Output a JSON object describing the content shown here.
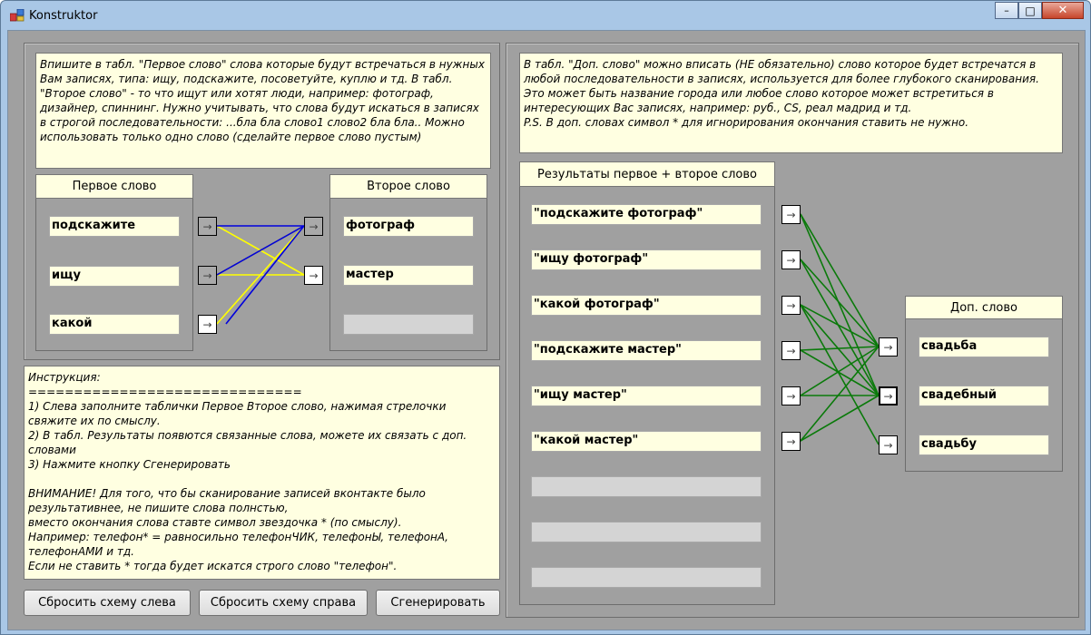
{
  "window": {
    "title": "Konstruktor",
    "minimize_glyph": "–",
    "maximize_glyph": "□",
    "close_glyph": "✕"
  },
  "arrow_glyph": "→",
  "left": {
    "info_text": "Впишите в табл. \"Первое слово\" слова которые будут встречаться в нужных Вам записях, типа: ищу, подскажите, посоветуйте, куплю и тд. В табл. \"Второе слово\" - то что ищут или хотят люди, например: фотограф,  дизайнер, спиннинг. Нужно учитывать, что слова будут искаться в записях в строгой последовательности: ...бла бла слово1 слово2 бла бла.. Можно использовать только одно слово (сделайте первое слово пустым)",
    "first_header": "Первое слово",
    "second_header": "Второе слово",
    "first_words": [
      "подскажите",
      "ищу",
      "какой"
    ],
    "second_words": [
      "фотограф",
      "мастер",
      ""
    ]
  },
  "instructions": "Инструкция:\n==============================\n1) Слева заполните таблички Первое Второе слово, нажимая стрелочки свяжите их по смыслу.\n2) В табл. Результаты появются связанные слова, можете их связать с доп. словами\n3) Нажмите кнопку Сгенерировать\n\nВНИМАНИЕ! Для того, что бы сканирование записей вконтакте было результативнее, не пишите слова полнстью,\nвместо окончания слова ставте символ звездочка * (по смыслу).\nНапример: телефон* = равносильно телефонЧИК, телефонЫ, телефонА, телефонАМИ и тд.\nЕсли не ставить * тогда будет искатся строго слово \"телефон\".",
  "buttons": {
    "reset_left": "Сбросить схему слева",
    "reset_right": "Сбросить схему справа",
    "generate": "Сгенерировать"
  },
  "right": {
    "info_text": "В табл. \"Доп. слово\" можно вписать (НЕ обязательно) слово которое будет встречатся в любой последовательности в записях, используется для более глубокого сканирования. Это может быть название города или любое слово которое может встретиться в интересующих Вас записях, например: руб., CS, реал мадрид и тд.\nP.S. В доп. словах символ * для игнорирования окончания ставить не нужно.",
    "results_header": "Результаты первое + второе слово",
    "results": [
      "\"подскажите фотограф\"",
      "\"ищу фотограф\"",
      "\"какой фотограф\"",
      "\"подскажите мастер\"",
      "\"ищу мастер\"",
      "\"какой мастер\"",
      "",
      "",
      ""
    ],
    "extra_header": "Доп. слово",
    "extra_words": [
      "свадьба",
      "свадебный",
      "свадьбу"
    ]
  },
  "colors": {
    "blue_link": "#0000dd",
    "yellow_link": "#ffff00",
    "green_link": "#0a7a0a",
    "note_bg": "#ffffe1",
    "client_bg": "#a0a0a0"
  }
}
